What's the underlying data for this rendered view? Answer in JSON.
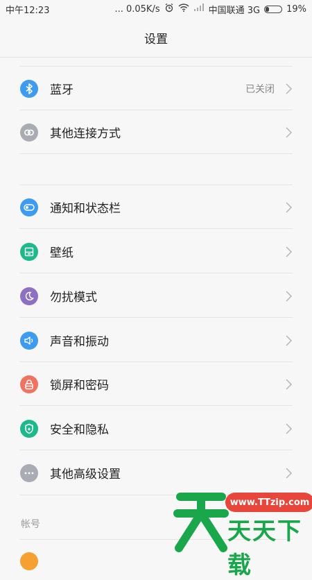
{
  "status_bar": {
    "time": "中午12:23",
    "network_speed": "... 0.05K/s",
    "carrier": "中国联通 3G",
    "battery": "19%"
  },
  "header": {
    "title": "设置"
  },
  "rows": [
    {
      "label": "蓝牙",
      "value": "已关闭",
      "icon": "bluetooth-icon",
      "color": "#3d9bf0"
    },
    {
      "label": "其他连接方式",
      "value": "",
      "icon": "link-icon",
      "color": "#a9adb3"
    },
    {
      "label": "通知和状态栏",
      "value": "",
      "icon": "toggle-icon",
      "color": "#3d9bf0"
    },
    {
      "label": "壁纸",
      "value": "",
      "icon": "wallpaper-icon",
      "color": "#1cb98a"
    },
    {
      "label": "勿扰模式",
      "value": "",
      "icon": "moon-icon",
      "color": "#8d6fc4"
    },
    {
      "label": "声音和振动",
      "value": "",
      "icon": "speaker-icon",
      "color": "#3d9bf0"
    },
    {
      "label": "锁屏和密码",
      "value": "",
      "icon": "lock-icon",
      "color": "#f07360"
    },
    {
      "label": "安全和隐私",
      "value": "",
      "icon": "shield-icon",
      "color": "#1cb98a"
    },
    {
      "label": "其他高级设置",
      "value": "",
      "icon": "more-icon",
      "color": "#a9adb3"
    }
  ],
  "sections": {
    "account_header": "帐号"
  },
  "watermark": {
    "url": "www.TTzip.com",
    "text": "天天下载",
    "accent": "#1aa64a",
    "badge_color": "#e8463b"
  }
}
